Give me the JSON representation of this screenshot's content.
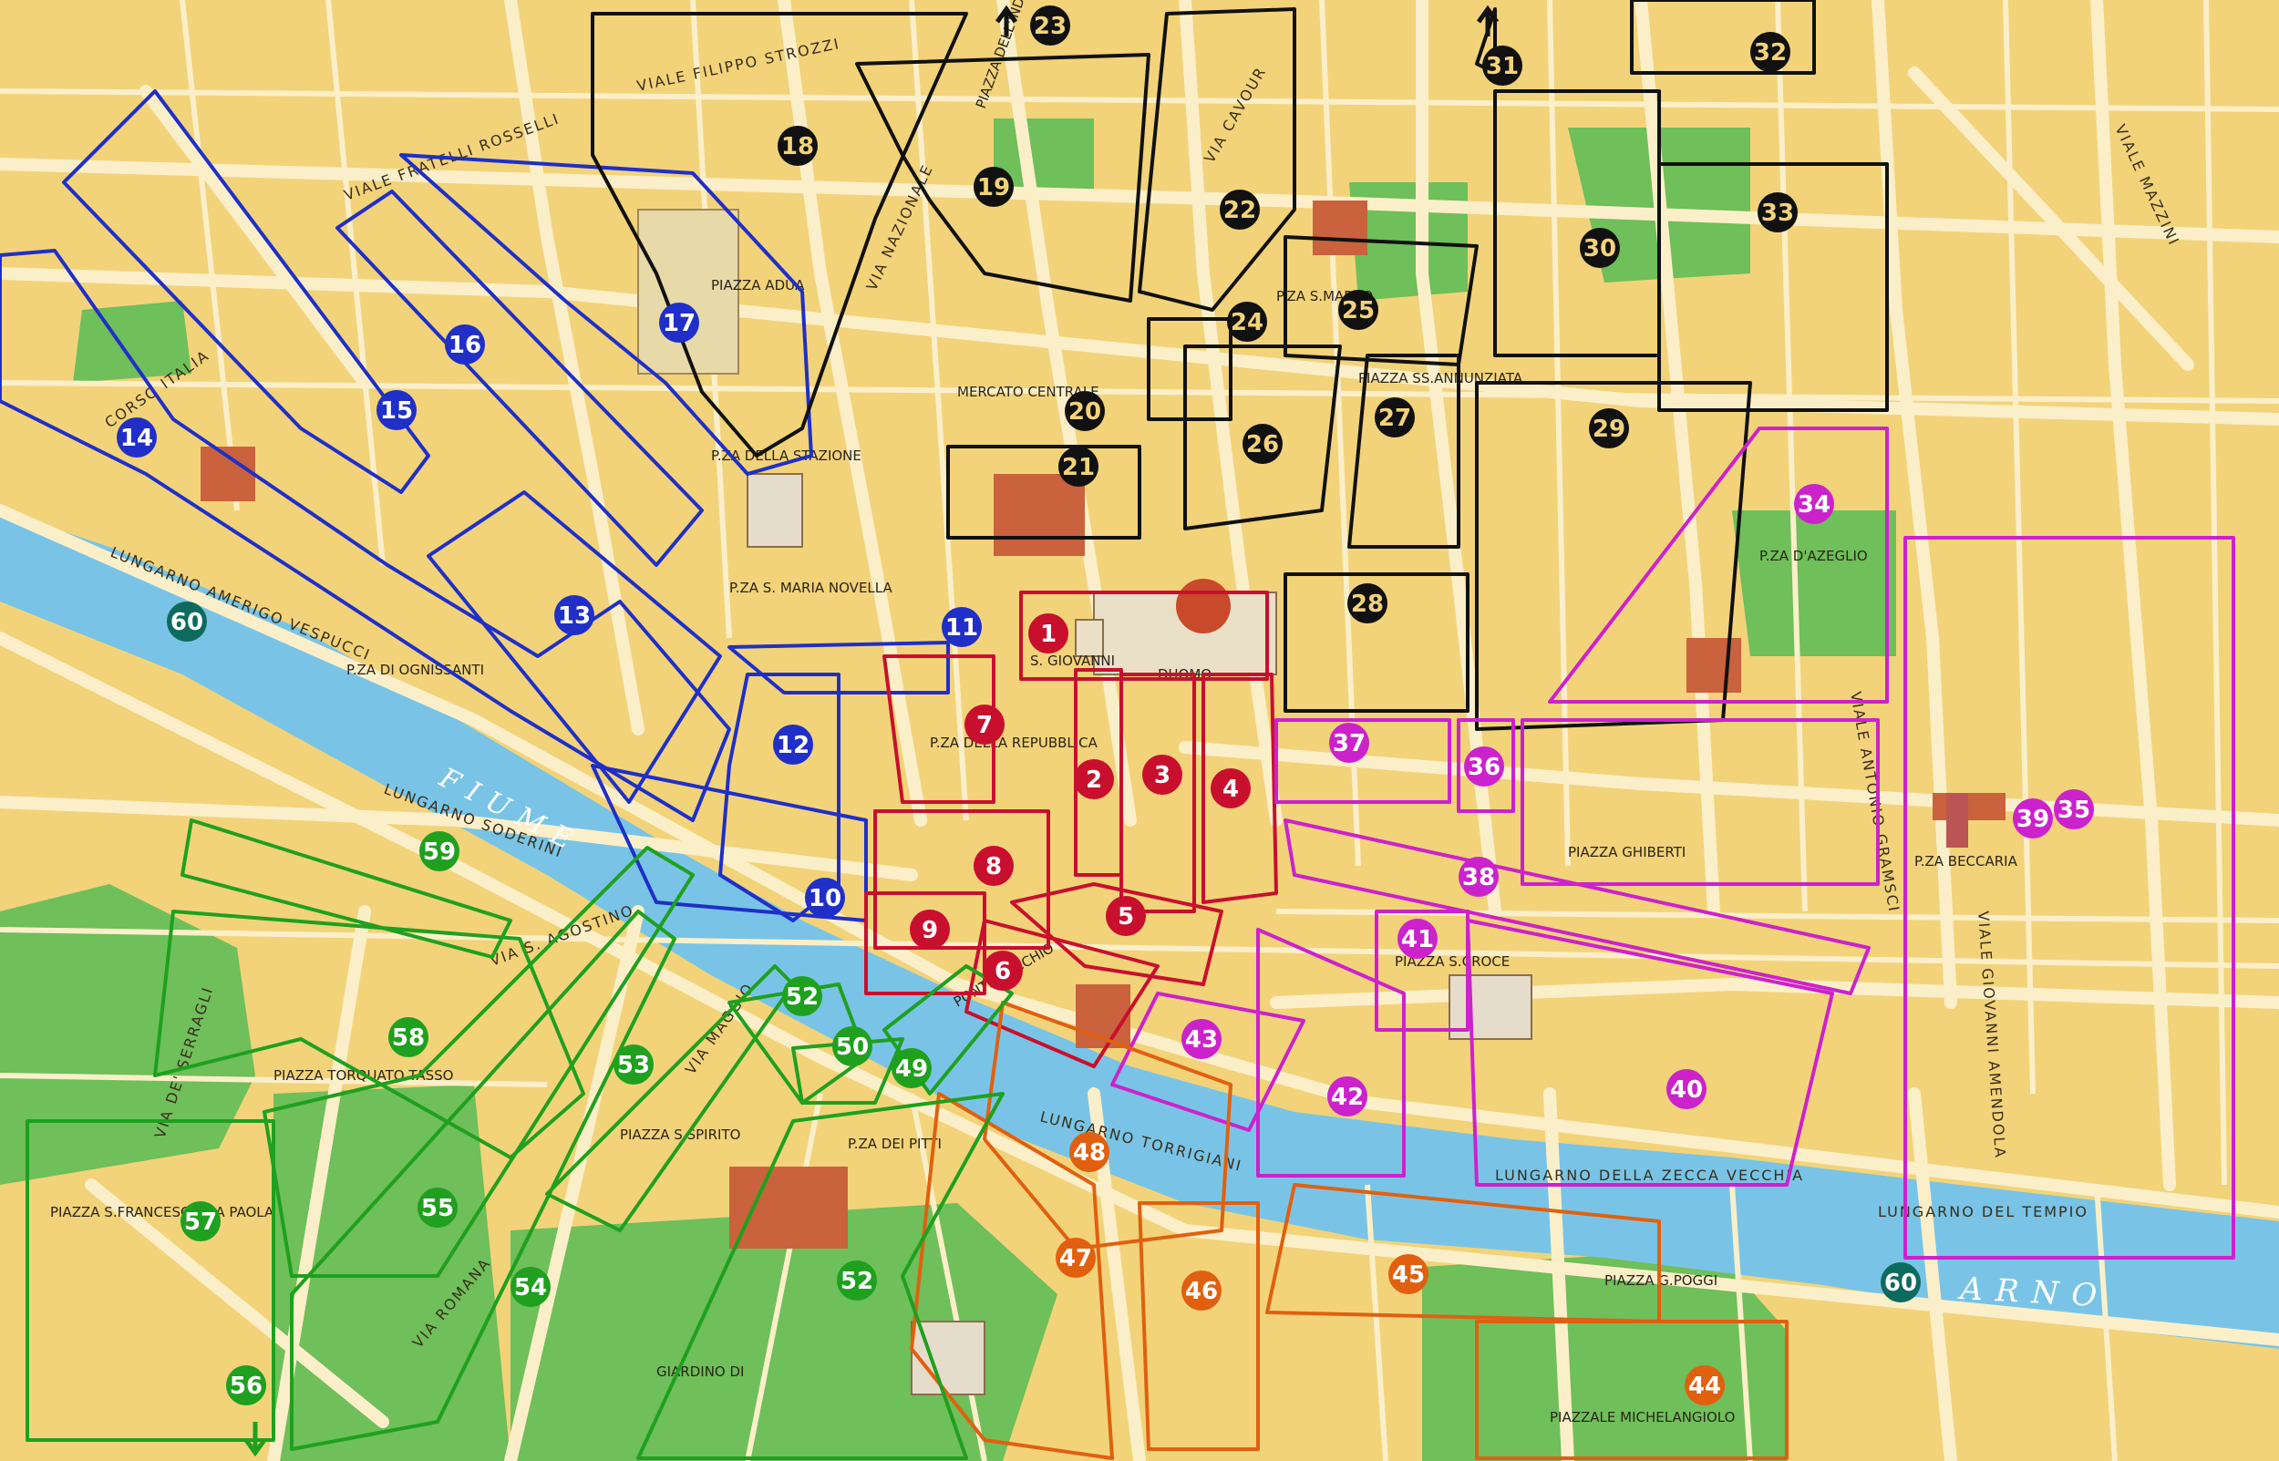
{
  "river": {
    "name": "ARNO",
    "label_upstream": "FIUME"
  },
  "colors": {
    "blue": "#1f2fc8",
    "black": "#111111",
    "red": "#c8102e",
    "magenta": "#cc22cc",
    "orange": "#e06010",
    "green": "#1fa01f",
    "teal": "#0d6b5e",
    "land": "#f2d37a",
    "street": "#fbefc9",
    "park": "#6fbf5a",
    "water": "#79c4e6"
  },
  "zones": [
    {
      "num": "1",
      "color": "red"
    },
    {
      "num": "2",
      "color": "red"
    },
    {
      "num": "3",
      "color": "red"
    },
    {
      "num": "4",
      "color": "red"
    },
    {
      "num": "5",
      "color": "red"
    },
    {
      "num": "6",
      "color": "red"
    },
    {
      "num": "7",
      "color": "red"
    },
    {
      "num": "8",
      "color": "red"
    },
    {
      "num": "9",
      "color": "red"
    },
    {
      "num": "10",
      "color": "blue"
    },
    {
      "num": "11",
      "color": "blue"
    },
    {
      "num": "12",
      "color": "blue"
    },
    {
      "num": "13",
      "color": "blue"
    },
    {
      "num": "14",
      "color": "blue"
    },
    {
      "num": "15",
      "color": "blue"
    },
    {
      "num": "16",
      "color": "blue"
    },
    {
      "num": "17",
      "color": "blue"
    },
    {
      "num": "18",
      "color": "black"
    },
    {
      "num": "19",
      "color": "black"
    },
    {
      "num": "20",
      "color": "black"
    },
    {
      "num": "21",
      "color": "black"
    },
    {
      "num": "22",
      "color": "black"
    },
    {
      "num": "23",
      "color": "black"
    },
    {
      "num": "24",
      "color": "black"
    },
    {
      "num": "25",
      "color": "black"
    },
    {
      "num": "26",
      "color": "black"
    },
    {
      "num": "27",
      "color": "black"
    },
    {
      "num": "28",
      "color": "black"
    },
    {
      "num": "29",
      "color": "black"
    },
    {
      "num": "30",
      "color": "black"
    },
    {
      "num": "31",
      "color": "black"
    },
    {
      "num": "32",
      "color": "black"
    },
    {
      "num": "33",
      "color": "black"
    },
    {
      "num": "34",
      "color": "magenta"
    },
    {
      "num": "35",
      "color": "magenta"
    },
    {
      "num": "36",
      "color": "magenta"
    },
    {
      "num": "37",
      "color": "magenta"
    },
    {
      "num": "38",
      "color": "magenta"
    },
    {
      "num": "39",
      "color": "magenta"
    },
    {
      "num": "40",
      "color": "magenta"
    },
    {
      "num": "41",
      "color": "magenta"
    },
    {
      "num": "42",
      "color": "magenta"
    },
    {
      "num": "43",
      "color": "magenta"
    },
    {
      "num": "44",
      "color": "orange"
    },
    {
      "num": "45",
      "color": "orange"
    },
    {
      "num": "46",
      "color": "orange"
    },
    {
      "num": "47",
      "color": "orange"
    },
    {
      "num": "48",
      "color": "orange"
    },
    {
      "num": "49",
      "color": "green"
    },
    {
      "num": "50",
      "color": "green"
    },
    {
      "num": "52",
      "color": "green"
    },
    {
      "num": "52",
      "color": "green"
    },
    {
      "num": "53",
      "color": "green"
    },
    {
      "num": "54",
      "color": "green"
    },
    {
      "num": "55",
      "color": "green"
    },
    {
      "num": "56",
      "color": "green"
    },
    {
      "num": "57",
      "color": "green"
    },
    {
      "num": "58",
      "color": "green"
    },
    {
      "num": "59",
      "color": "green"
    },
    {
      "num": "60",
      "color": "teal"
    },
    {
      "num": "60",
      "color": "teal"
    }
  ],
  "labels": {
    "viale_filippo_strozzi": "VIALE FILIPPO STROZZI",
    "viale_fratelli_rosselli": "VIALE FRATELLI ROSSELLI",
    "piazza_adua": "PIAZZA ADUA",
    "pza_della_stazione": "P.ZA DELLA STAZIONE",
    "santa_maria_novella": "P.ZA S. MARIA NOVELLA",
    "duomo": "DUOMO",
    "san_giovanni": "S. GIOVANNI",
    "mercato_centrale": "MERCATO CENTRALE",
    "pza_della_repubblica": "P.ZA DELLA REPUBBLICA",
    "lungarno_amerigo_vespucci": "LUNGARNO AMERIGO VESPUCCI",
    "lungarno_soderini": "LUNGARNO SODERINI",
    "lungarno_della_zecca_vecchia": "LUNGARNO DELLA ZECCA VECCHIA",
    "lungarno_del_tempio": "LUNGARNO DEL TEMPIO",
    "lungarno_torrigiani": "LUNGARNO TORRIGIANI",
    "piazza_torquato_tasso": "PIAZZA TORQUATO TASSO",
    "piazza_sfrancesco_da_paola": "PIAZZA S.FRANCESCO DA PAOLA",
    "giardino_di_boboli": "GIARDINO DI",
    "piazzale_michelangiolo": "PIAZZALE MICHELANGIOLO",
    "piazza_scroce": "PIAZZA S.CROCE",
    "piazza_ss_annunziata": "PIAZZA SS.ANNUNZIATA",
    "piazza_dazeglio": "P.ZA D'AZEGLIO",
    "piazza_beccaria": "P.ZA BECCARIA",
    "piazza_ghiberti": "PIAZZA GHIBERTI",
    "piazza_dellindipendenza": "PIAZZA DELL'INDIPENDENZA",
    "piazza_san_marco": "P.ZA S.MARCO",
    "viale_giovanni_amendola": "VIALE GIOVANNI AMENDOLA",
    "viale_antonio_gramsci": "VIALE ANTONIO GRAMSCI",
    "via_cavour": "VIA CAVOUR",
    "piazza_spirito": "PIAZZA S.SPIRITO",
    "piazza_pitti": "P.ZA DEI PITTI",
    "via_romana": "VIA ROMANA",
    "via_maggio": "VIA MAGGIO",
    "ponte_vecchio": "PONTE VECCHIO",
    "corso_italia": "CORSO ITALIA",
    "piazza_poggi": "PIAZZA G.POGGI",
    "viale_mazzini": "VIALE MAZZINI",
    "piazza_ognissanti": "P.ZA DI OGNISSANTI",
    "via_nazionale": "VIA NAZIONALE",
    "via_santagostino": "VIA S. AGOSTINO",
    "via_dei_serragli": "VIA DE' SERRAGLI"
  }
}
